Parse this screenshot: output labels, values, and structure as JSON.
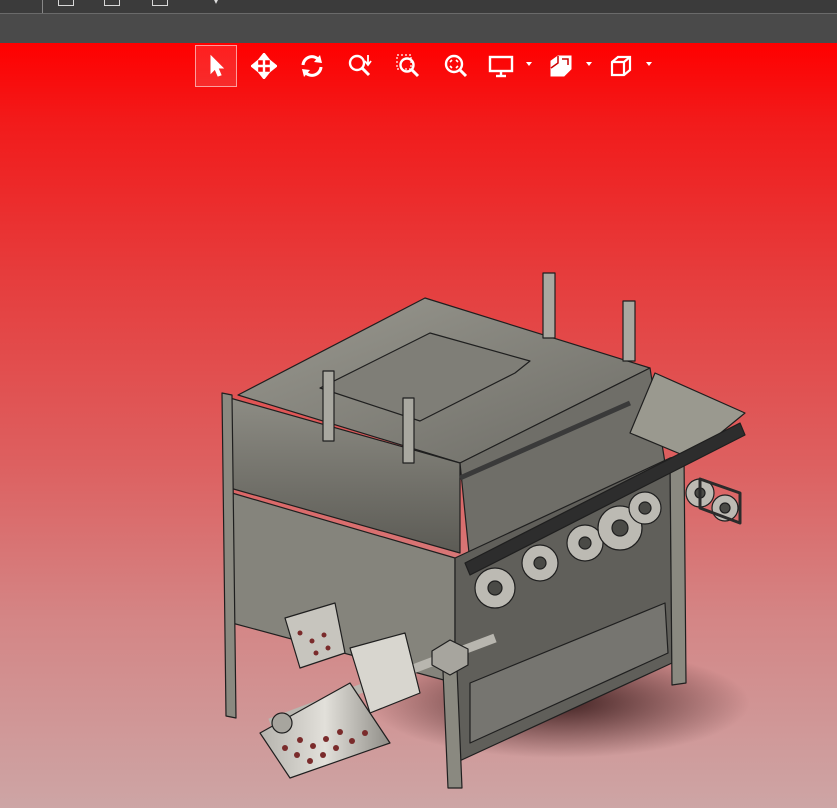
{
  "window": {
    "toolbar_icons": [
      "menu-icon",
      "save-copy-icon",
      "print-icon",
      "dropdown-caret-icon"
    ]
  },
  "heads_up_toolbar": {
    "tools": [
      {
        "name": "select",
        "icon": "cursor-arrow-icon",
        "active": true
      },
      {
        "name": "pan",
        "icon": "move-arrows-icon"
      },
      {
        "name": "rotate",
        "icon": "rotate-view-icon"
      },
      {
        "name": "zoom-in-out",
        "icon": "zoom-in-out-icon"
      },
      {
        "name": "zoom-to-area",
        "icon": "zoom-area-icon"
      },
      {
        "name": "zoom-to-fit",
        "icon": "zoom-fit-icon"
      },
      {
        "name": "display-style",
        "icon": "monitor-icon",
        "has_dropdown": true
      },
      {
        "name": "section-view",
        "icon": "section-view-icon",
        "has_dropdown": true
      },
      {
        "name": "view-orientation",
        "icon": "cube-view-icon",
        "has_dropdown": true
      }
    ]
  },
  "viewport": {
    "background_top": "#ff0000",
    "background_bottom": "#cda5a5",
    "model_color": "#8c8b82",
    "model_outline": "#1f1f1f"
  }
}
